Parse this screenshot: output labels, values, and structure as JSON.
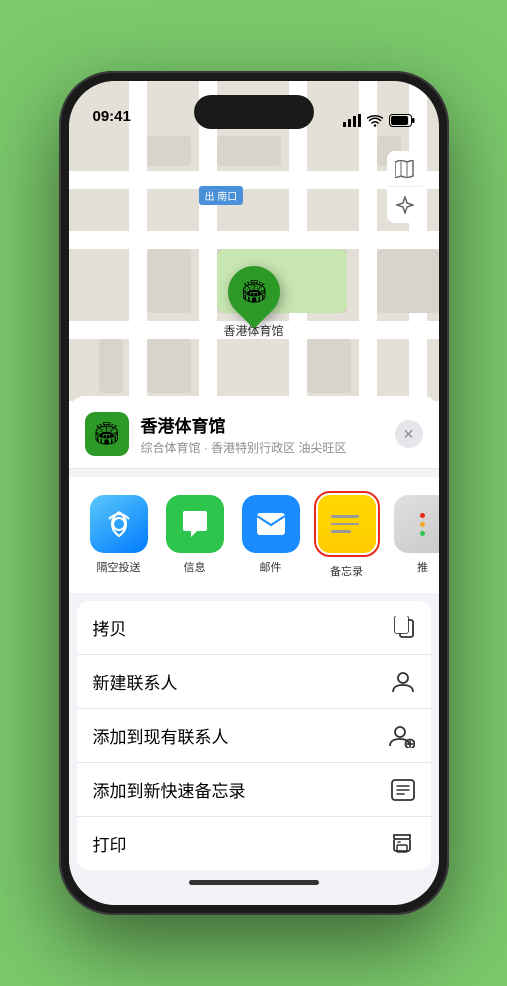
{
  "status_bar": {
    "time": "09:41",
    "signal": "●●●●",
    "wifi": "wifi",
    "battery": "battery"
  },
  "map": {
    "exit_label": "南口",
    "exit_prefix": "出"
  },
  "pin": {
    "label": "香港体育馆"
  },
  "sheet": {
    "close_label": "✕",
    "venue_name": "香港体育馆",
    "venue_sub": "综合体育馆 · 香港特别行政区 油尖旺区"
  },
  "share_items": [
    {
      "id": "airdrop",
      "label": "隔空投送",
      "icon_type": "airdrop"
    },
    {
      "id": "messages",
      "label": "信息",
      "icon_type": "messages"
    },
    {
      "id": "mail",
      "label": "邮件",
      "icon_type": "mail"
    },
    {
      "id": "notes",
      "label": "备忘录",
      "icon_type": "notes",
      "selected": true
    },
    {
      "id": "more",
      "label": "推",
      "icon_type": "more"
    }
  ],
  "actions": [
    {
      "id": "copy",
      "label": "拷贝",
      "icon": "📋"
    },
    {
      "id": "new-contact",
      "label": "新建联系人",
      "icon": "👤"
    },
    {
      "id": "add-contact",
      "label": "添加到现有联系人",
      "icon": "👤"
    },
    {
      "id": "quick-note",
      "label": "添加到新快速备忘录",
      "icon": "📝"
    },
    {
      "id": "print",
      "label": "打印",
      "icon": "🖨️"
    }
  ],
  "home_indicator": ""
}
